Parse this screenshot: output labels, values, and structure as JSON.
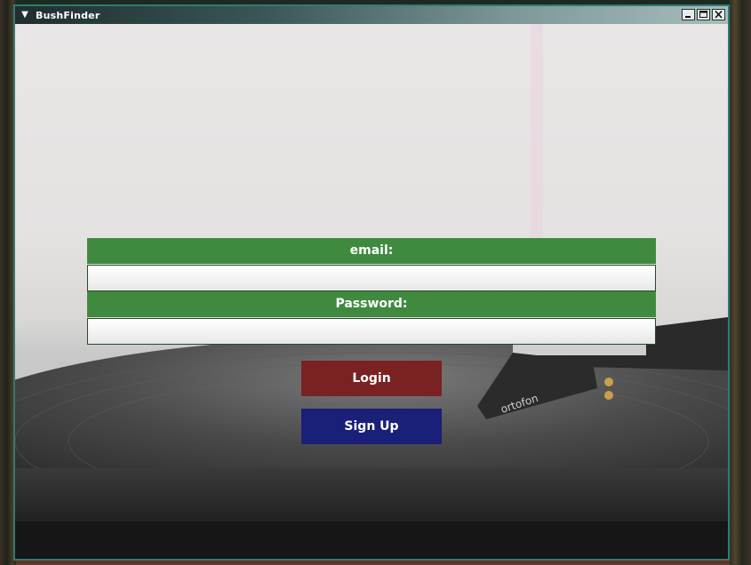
{
  "window": {
    "title": "BushFinder",
    "controls": {
      "minimize": "minimize-icon",
      "maximize": "maximize-icon",
      "close": "close-icon"
    }
  },
  "form": {
    "email_label": "email:",
    "email_value": "",
    "password_label": "Password:",
    "password_value": "",
    "login_label": "Login",
    "signup_label": "Sign Up"
  },
  "background": {
    "cartridge_brand": "ortofon"
  },
  "colors": {
    "label_bg": "#3f8a3f",
    "login_bg": "#7a2222",
    "signup_bg": "#1a1f78",
    "frame": "#2f7a78"
  }
}
